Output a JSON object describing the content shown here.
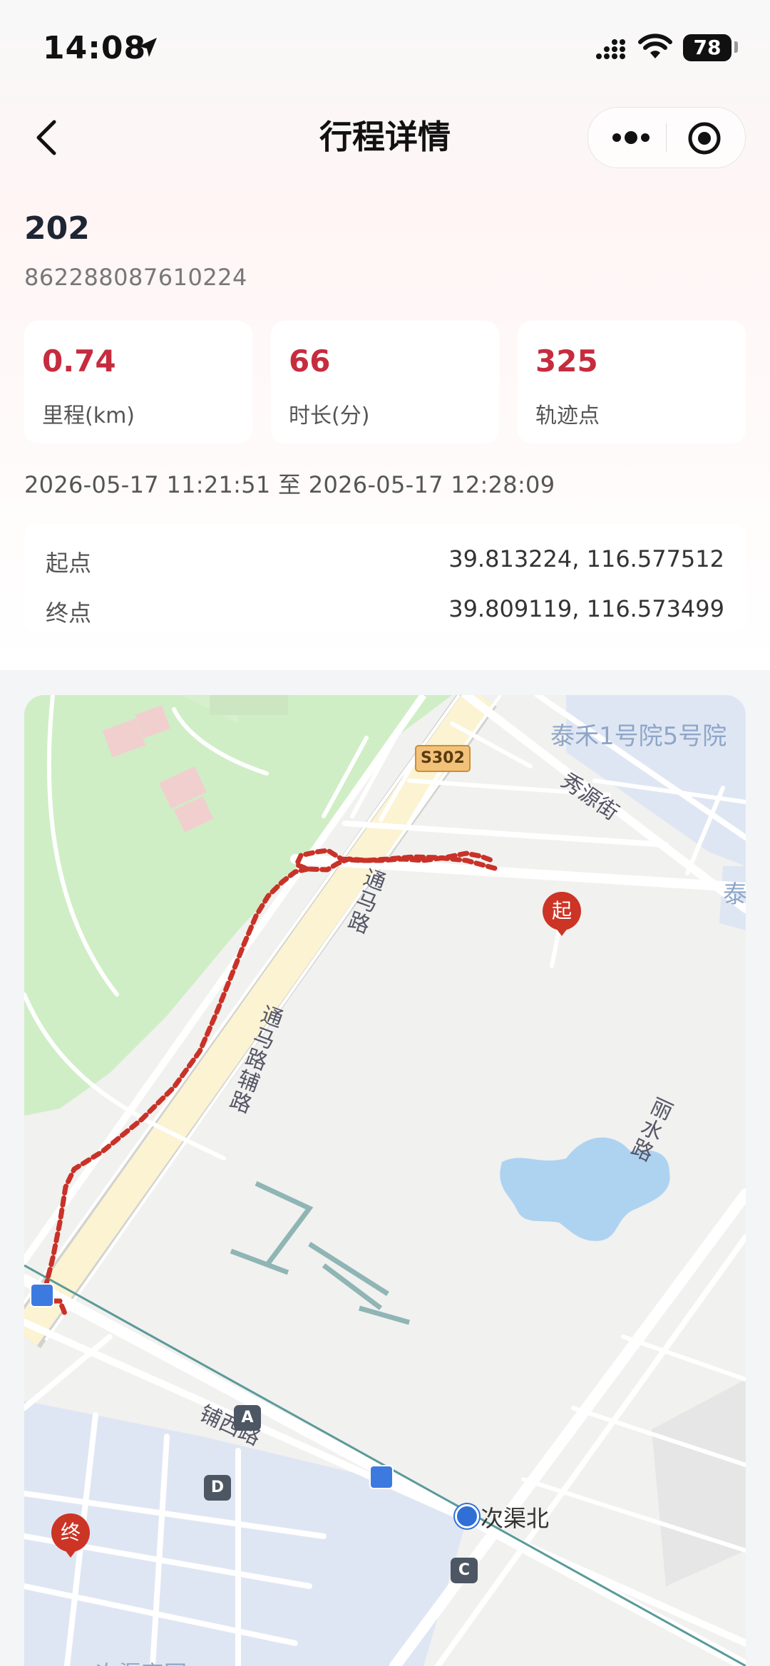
{
  "status_bar": {
    "time": "14:08",
    "battery": "78"
  },
  "nav": {
    "title": "行程详情"
  },
  "device": {
    "name": "202",
    "id": "862288087610224"
  },
  "stats": [
    {
      "value": "0.74",
      "label": "里程(km)"
    },
    {
      "value": "66",
      "label": "时长(分)"
    },
    {
      "value": "325",
      "label": "轨迹点"
    }
  ],
  "time_range": "2026-05-17 11:21:51 至 2026-05-17 12:28:09",
  "points": {
    "start": {
      "label": "起点",
      "value": "39.813224, 116.577512"
    },
    "end": {
      "label": "终点",
      "value": "39.809119, 116.573499"
    }
  },
  "map": {
    "labels": {
      "highway": "S302",
      "road_tongma": "通马路",
      "road_tongma_aux": "通马路辅路",
      "road_xiuyuan": "秀源街",
      "community_taihe": "泰禾1号院5号院",
      "community_tai": "泰",
      "road_lishui": "丽水路",
      "road_puxi": "铺西路",
      "station": "次渠北",
      "community_bottom": "次渠家园"
    },
    "exits": [
      "A",
      "D",
      "C"
    ],
    "start_marker": "起",
    "end_marker": "终",
    "route_color": "#c83228"
  }
}
